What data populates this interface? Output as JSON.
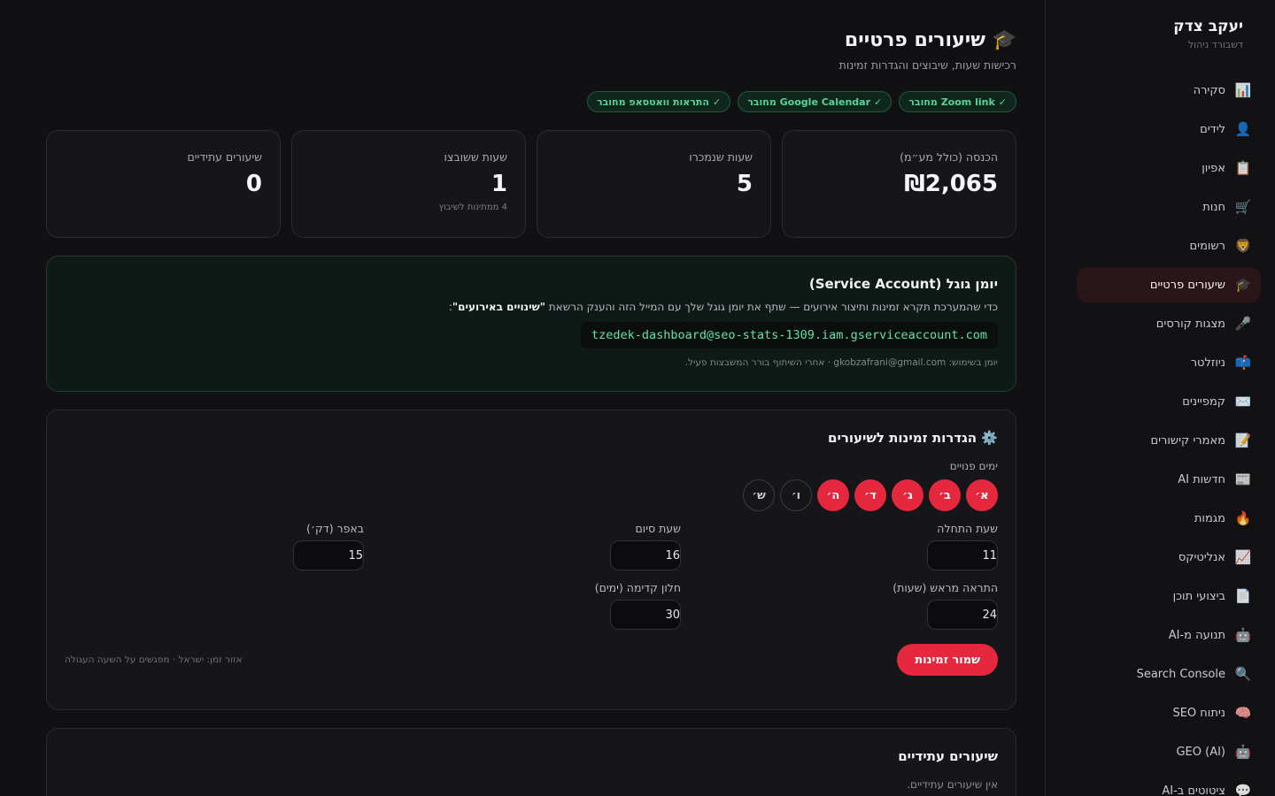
{
  "sidebar": {
    "brand_name": "יעקב צדק",
    "brand_sub": "דשבורד ניהול",
    "items": [
      {
        "label": "סקירה",
        "icon": "📊",
        "icon_name": "bar-chart-icon"
      },
      {
        "label": "לידים",
        "icon": "👤",
        "icon_name": "user-icon"
      },
      {
        "label": "אפיון",
        "icon": "📋",
        "icon_name": "clipboard-icon"
      },
      {
        "label": "חנות",
        "icon": "🛒",
        "icon_name": "cart-icon"
      },
      {
        "label": "רשומים",
        "icon": "🦁",
        "icon_name": "lion-icon"
      },
      {
        "label": "שיעורים פרטיים",
        "icon": "🎓",
        "icon_name": "graduation-cap-icon",
        "active": true
      },
      {
        "label": "מצגות קורסים",
        "icon": "🎤",
        "icon_name": "microphone-icon"
      },
      {
        "label": "ניוזלטר",
        "icon": "📫",
        "icon_name": "mailbox-icon"
      },
      {
        "label": "קמפיינים",
        "icon": "✉️",
        "icon_name": "envelope-icon"
      },
      {
        "label": "מאמרי קישורים",
        "icon": "📝",
        "icon_name": "memo-icon"
      },
      {
        "label": "חדשות AI",
        "icon": "📰",
        "icon_name": "newspaper-icon"
      },
      {
        "label": "מגמות",
        "icon": "🔥",
        "icon_name": "fire-icon"
      },
      {
        "label": "אנליטיקס",
        "icon": "📈",
        "icon_name": "trend-icon"
      },
      {
        "label": "ביצועי תוכן",
        "icon": "📄",
        "icon_name": "document-icon"
      },
      {
        "label": "תנועה מ-AI",
        "icon": "🤖",
        "icon_name": "robot-icon"
      },
      {
        "label": "Search Console",
        "icon": "🔍",
        "icon_name": "search-icon"
      },
      {
        "label": "ניתוח SEO",
        "icon": "🧠",
        "icon_name": "brain-icon"
      },
      {
        "label": "GEO (AI)",
        "icon": "🤖",
        "icon_name": "robot-icon"
      },
      {
        "label": "ציטוטים ב-AI",
        "icon": "💬",
        "icon_name": "chat-icon"
      }
    ]
  },
  "header": {
    "icon": "🎓",
    "title": "שיעורים פרטיים",
    "subtitle": "רכישות שעות, שיבוצים והגדרות זמינות"
  },
  "badges": [
    {
      "check": "✓",
      "label": "Zoom link מחובר"
    },
    {
      "check": "✓",
      "label": "Google Calendar מחובר"
    },
    {
      "check": "✓",
      "label": "התראות וואטסאפ מחובר"
    }
  ],
  "stats": [
    {
      "label": "הכנסה (כולל מע״מ)",
      "value": "₪2,065",
      "note": ""
    },
    {
      "label": "שעות שנמכרו",
      "value": "5",
      "note": ""
    },
    {
      "label": "שעות ששובצו",
      "value": "1",
      "note": "4 ממתינות לשיבוץ"
    },
    {
      "label": "שיעורים עתידיים",
      "value": "0",
      "note": ""
    }
  ],
  "gcal": {
    "title": "יומן גוגל (Service Account)",
    "desc_prefix": "כדי שהמערכת תקרא זמינות ותיצור אירועים — שתף את יומן גוגל שלך עם המייל הזה והענק הרשאת ",
    "desc_bold": "\"שינויים באירועים\"",
    "desc_suffix": ":",
    "email": "tzedek-dashboard@seo-stats-1309.iam.gserviceaccount.com",
    "footnote": "יומן בשימוש: gkobzafrani@gmail.com · אחרי השיתוף בורר המשבצות פעיל."
  },
  "availability": {
    "icon": "⚙️",
    "title": "הגדרות זמינות לשיעורים",
    "days_label": "ימים פנויים",
    "days": [
      {
        "label": "א׳",
        "on": true
      },
      {
        "label": "ב׳",
        "on": true
      },
      {
        "label": "ג׳",
        "on": true
      },
      {
        "label": "ד׳",
        "on": true
      },
      {
        "label": "ה׳",
        "on": true
      },
      {
        "label": "ו׳",
        "on": false
      },
      {
        "label": "ש׳",
        "on": false
      }
    ],
    "start_label": "שעת התחלה",
    "start_value": "11",
    "end_label": "שעת סיום",
    "end_value": "16",
    "buffer_label": "באפר (דק׳)",
    "buffer_value": "15",
    "notice_label": "התראה מראש (שעות)",
    "notice_value": "24",
    "window_label": "חלון קדימה (ימים)",
    "window_value": "30",
    "save_label": "שמור זמינות",
    "tz_note": "אזור זמן: ישראל · מפגשים על השעה העגולה"
  },
  "future": {
    "title": "שיעורים עתידיים",
    "empty": "אין שיעורים עתידיים."
  },
  "colors": {
    "accent": "#e5283d",
    "success": "#58d39a",
    "background": "#111114"
  }
}
